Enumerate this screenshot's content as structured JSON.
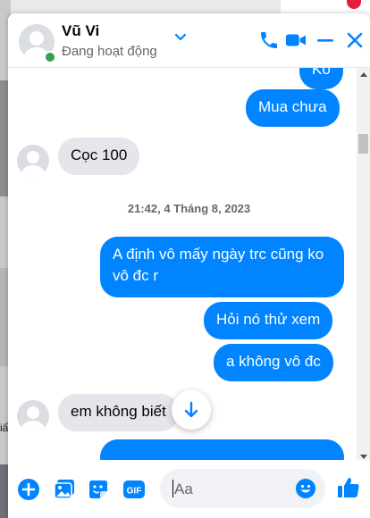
{
  "background": {
    "partial_text": "iấ"
  },
  "header": {
    "name": "Vũ Vi",
    "status": "Đang hoạt động"
  },
  "messages": [
    {
      "id": "m1",
      "direction": "outgoing",
      "text": "Ko"
    },
    {
      "id": "m2",
      "direction": "outgoing",
      "text": "Mua chưa"
    },
    {
      "id": "m3",
      "direction": "incoming",
      "text": "Cọc 100"
    },
    {
      "id": "m5",
      "direction": "outgoing",
      "text": "A định vô mấy ngày trc cũng ko vô đc r"
    },
    {
      "id": "m6",
      "direction": "outgoing",
      "text": "Hỏi nó thử xem"
    },
    {
      "id": "m7",
      "direction": "outgoing",
      "text": "a không vô đc"
    },
    {
      "id": "m8",
      "direction": "incoming",
      "text": "em không biết"
    }
  ],
  "timestamp": "21:42, 4 Tháng 8, 2023",
  "composer": {
    "placeholder": "Aa"
  },
  "colors": {
    "accent": "#0084ff",
    "incoming_bubble": "#e4e6eb",
    "online": "#31a24c"
  },
  "icons": {
    "header": [
      "chevron-down-icon",
      "phone-icon",
      "video-icon",
      "minimize-icon",
      "close-icon"
    ],
    "composer": [
      "plus-icon",
      "image-icon",
      "sticker-icon",
      "gif-icon",
      "emoji-icon",
      "like-icon"
    ],
    "scroll": "arrow-down-icon"
  }
}
